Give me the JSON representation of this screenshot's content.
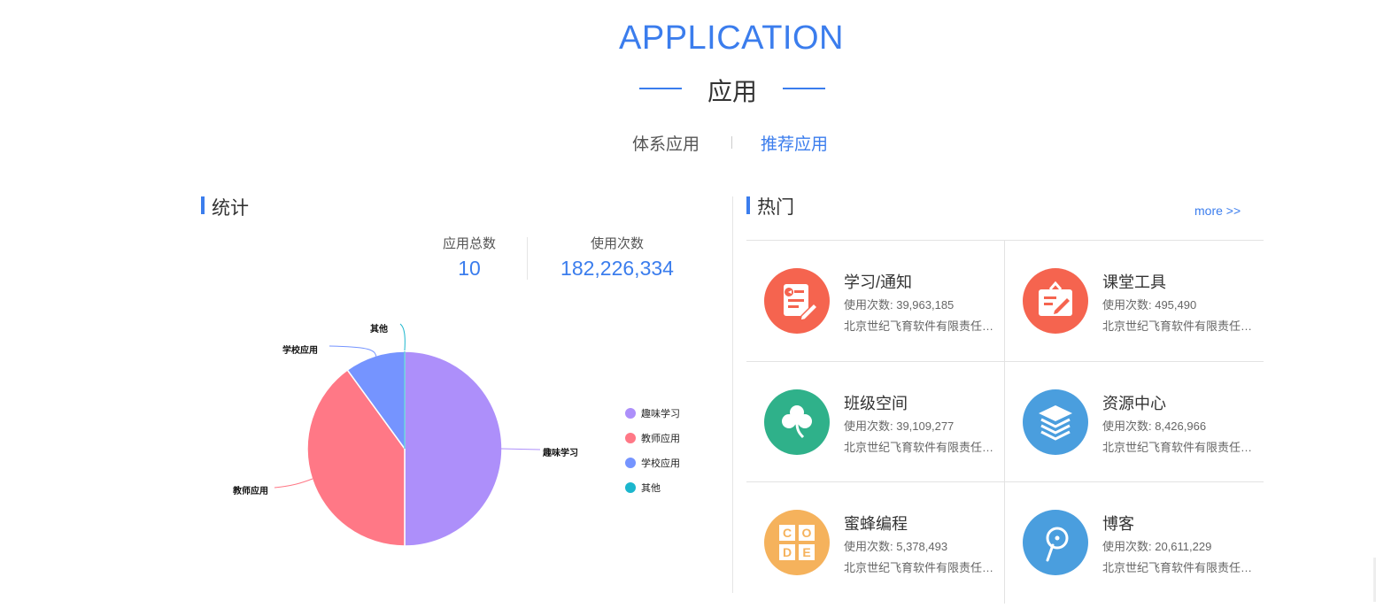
{
  "header": {
    "title_en": "APPLICATION",
    "title_cn": "应用",
    "accent_color": "#3b7ded"
  },
  "tabs": [
    {
      "label": "体系应用",
      "active": false
    },
    {
      "label": "推荐应用",
      "active": true
    }
  ],
  "stats_section": {
    "title": "统计",
    "total_label": "应用总数",
    "total_value": "10",
    "uses_label": "使用次数",
    "uses_value": "182,226,334"
  },
  "chart_data": {
    "type": "pie",
    "slices": [
      {
        "name": "趣味学习",
        "value": 50,
        "color": "#ad8ffa"
      },
      {
        "name": "教师应用",
        "value": 40,
        "color": "#ff7886"
      },
      {
        "name": "学校应用",
        "value": 10,
        "color": "#7594ff"
      },
      {
        "name": "其他",
        "value": 0,
        "color": "#1bb6cd"
      }
    ],
    "legend": [
      "趣味学习",
      "教师应用",
      "学校应用",
      "其他"
    ],
    "legend_position": "right"
  },
  "hot_section": {
    "title": "热门",
    "more_label": "more >>",
    "apps": [
      {
        "name": "学习/通知",
        "uses": "使用次数: 39,963,185",
        "company": "北京世纪飞育软件有限责任公司",
        "icon": "notice-icon",
        "color": "#f5644f"
      },
      {
        "name": "课堂工具",
        "uses": "使用次数: 495,490",
        "company": "北京世纪飞育软件有限责任公司",
        "icon": "clipboard-pen-icon",
        "color": "#f5644f"
      },
      {
        "name": "班级空间",
        "uses": "使用次数: 39,109,277",
        "company": "北京世纪飞育软件有限责任公司",
        "icon": "clover-icon",
        "color": "#2fb18a"
      },
      {
        "name": "资源中心",
        "uses": "使用次数: 8,426,966",
        "company": "北京世纪飞育软件有限责任公司",
        "icon": "layers-icon",
        "color": "#4a9ede"
      },
      {
        "name": "蜜蜂编程",
        "uses": "使用次数: 5,378,493",
        "company": "北京世纪飞育软件有限责任公司",
        "icon": "code-blocks-icon",
        "color": "#f5b25c"
      },
      {
        "name": "博客",
        "uses": "使用次数: 20,611,229",
        "company": "北京世纪飞育软件有限责任公司",
        "icon": "blog-pen-icon",
        "color": "#4a9ede"
      }
    ]
  }
}
